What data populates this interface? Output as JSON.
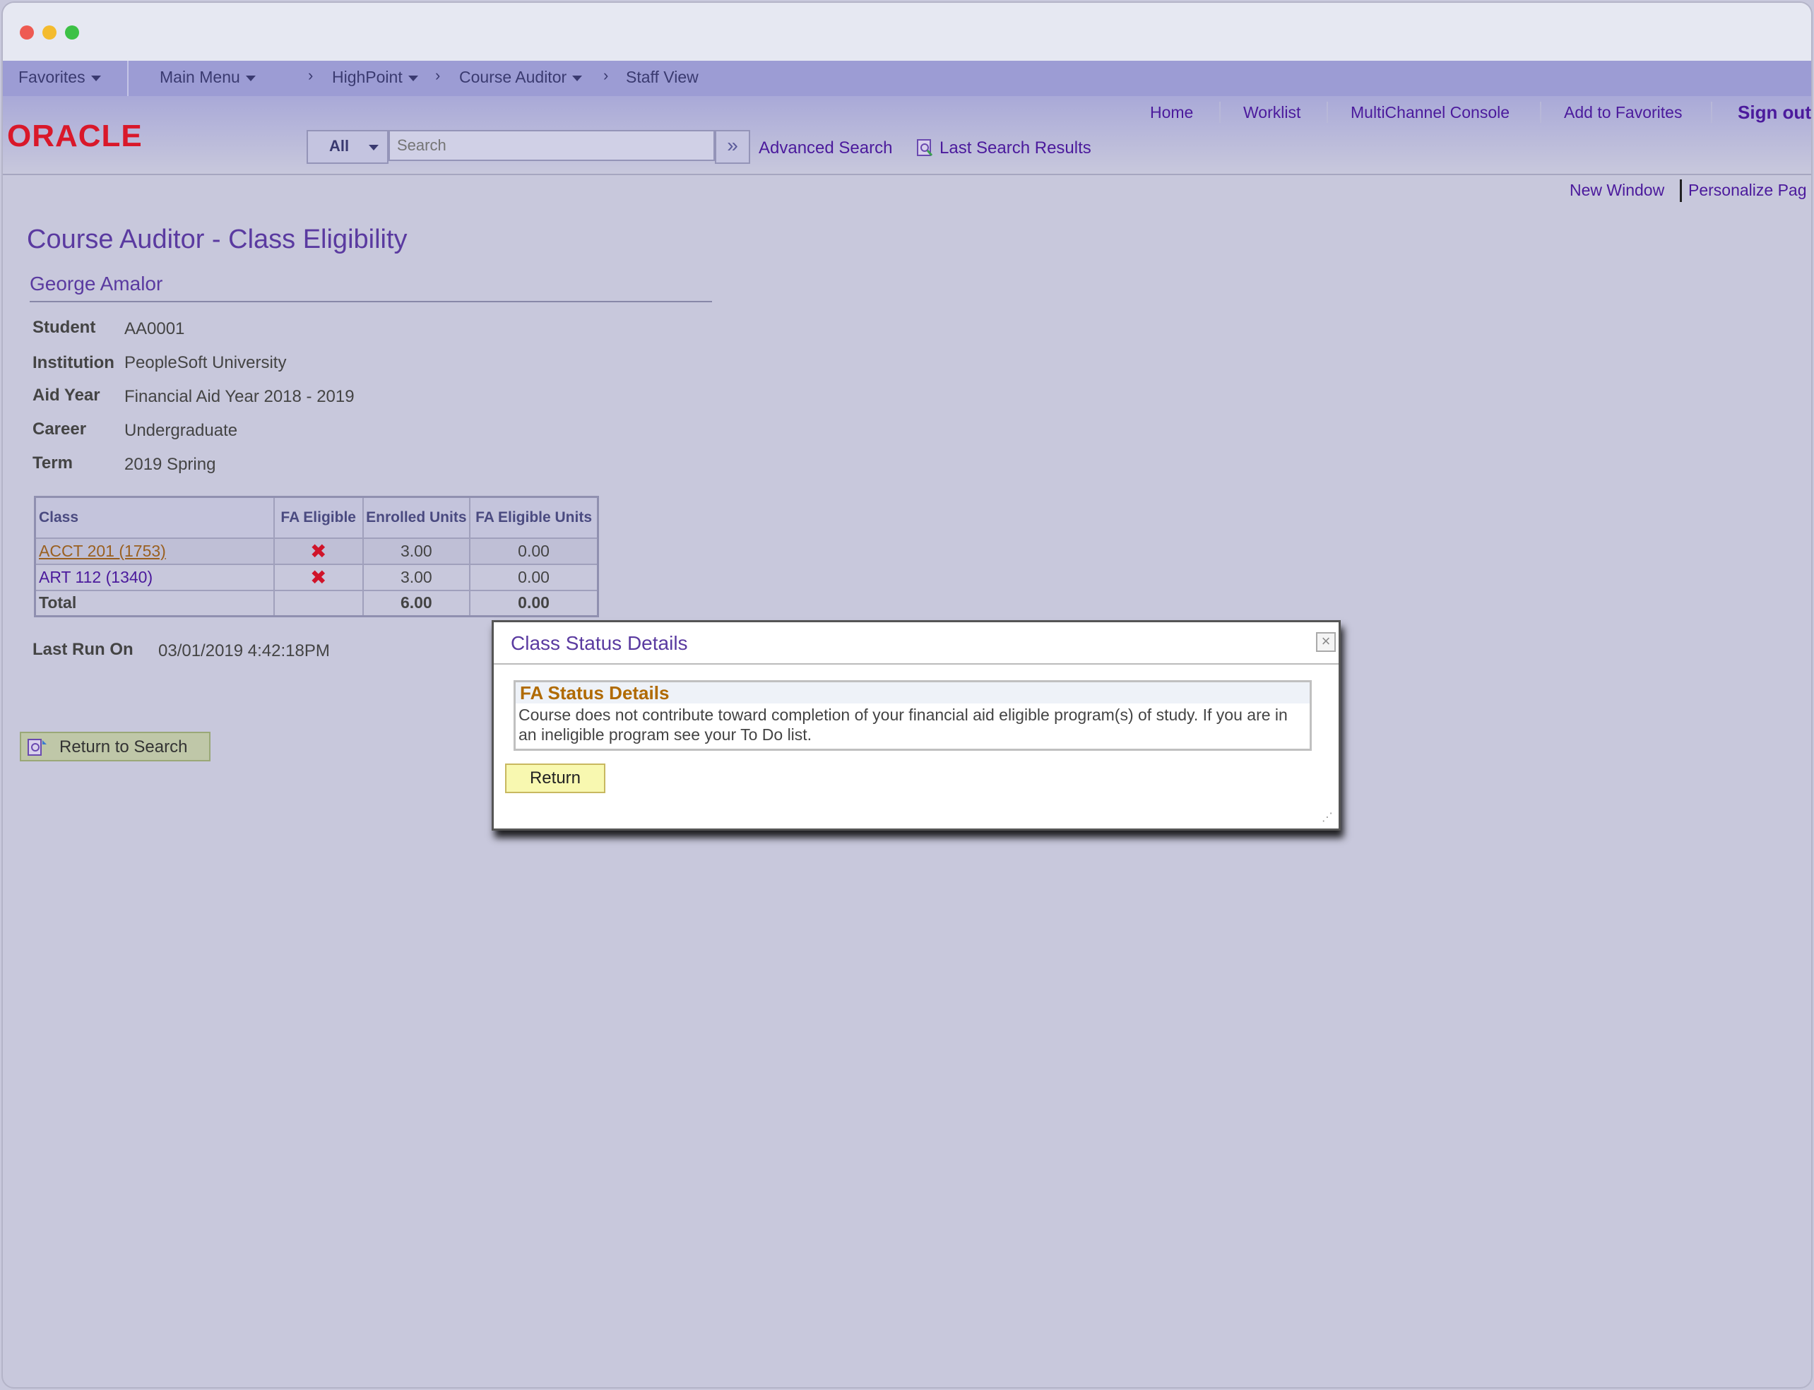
{
  "navbar": {
    "favorites": "Favorites",
    "main_menu": "Main Menu",
    "crumbs": [
      "HighPoint",
      "Course Auditor",
      "Staff View"
    ]
  },
  "header": {
    "logo": "ORACLE",
    "links": [
      "Home",
      "Worklist",
      "MultiChannel Console",
      "Add to Favorites"
    ],
    "sign_out": "Sign out",
    "search_category": "All",
    "search_placeholder": "Search",
    "advanced_search": "Advanced Search",
    "last_search_results": "Last Search Results"
  },
  "pagelinks": {
    "new_window": "New Window",
    "personalize": "Personalize Pag"
  },
  "page": {
    "title": "Course Auditor - Class Eligibility",
    "person_name": "George Amalor",
    "fields": [
      {
        "label": "Student",
        "value": "AA0001"
      },
      {
        "label": "Institution",
        "value": "PeopleSoft University"
      },
      {
        "label": "Aid Year",
        "value": "Financial Aid Year 2018 - 2019"
      },
      {
        "label": "Career",
        "value": "Undergraduate"
      },
      {
        "label": "Term",
        "value": "2019 Spring"
      }
    ],
    "table": {
      "headers": [
        "Class",
        "FA Eligible",
        "Enrolled Units",
        "FA Eligible Units"
      ],
      "rows": [
        {
          "class": "ACCT 201 (1753)",
          "fa_eligible": "✖",
          "enrolled": "3.00",
          "fa_units": "0.00"
        },
        {
          "class": "ART 112 (1340)",
          "fa_eligible": "✖",
          "enrolled": "3.00",
          "fa_units": "0.00"
        }
      ],
      "total": {
        "label": "Total",
        "enrolled": "6.00",
        "fa_units": "0.00"
      }
    },
    "last_run_label": "Last Run On",
    "last_run_value": "03/01/2019  4:42:18PM",
    "return_to_search": "Return to Search"
  },
  "modal": {
    "title": "Class Status Details",
    "close": "×",
    "section_title": "FA Status Details",
    "message": "Course does not contribute toward completion of your financial aid eligible program(s) of study.  If you are in an ineligible program see your To Do list.",
    "return_label": "Return"
  },
  "colors": {
    "accent": "#4b1a9c",
    "nav": "#9c9cd4",
    "logo": "#d9182a",
    "error": "#d0142a"
  },
  "icons": [
    "chevron-down-icon",
    "breadcrumb-arrow-icon",
    "double-chevron-right-icon",
    "magnifier-icon",
    "close-icon",
    "resize-grip-icon"
  ]
}
